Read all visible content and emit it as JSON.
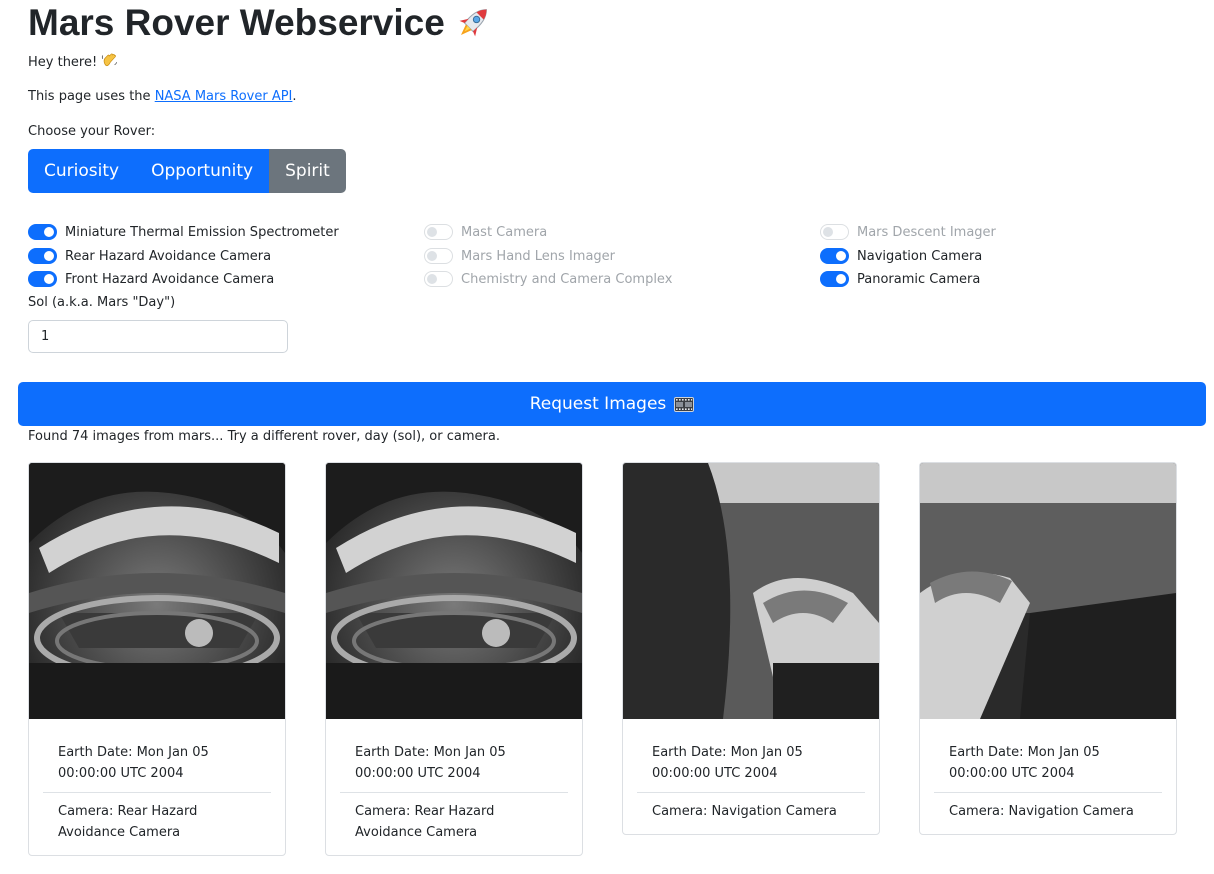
{
  "header": {
    "title": "Mars Rover Webservice"
  },
  "intro": {
    "greeting": "Hey there!",
    "api_prefix": "This page uses the ",
    "api_link": "NASA Mars Rover API",
    "api_suffix": ".",
    "rover_prompt": "Choose your Rover:"
  },
  "rovers": [
    {
      "label": "Curiosity",
      "selected": false
    },
    {
      "label": "Opportunity",
      "selected": false
    },
    {
      "label": "Spirit",
      "selected": true
    }
  ],
  "cameras": [
    {
      "label": "Miniature Thermal Emission Spectrometer",
      "on": true,
      "enabled": true
    },
    {
      "label": "Rear Hazard Avoidance Camera",
      "on": true,
      "enabled": true
    },
    {
      "label": "Front Hazard Avoidance Camera",
      "on": true,
      "enabled": true
    },
    {
      "label": "Mast Camera",
      "on": false,
      "enabled": false
    },
    {
      "label": "Mars Hand Lens Imager",
      "on": false,
      "enabled": false
    },
    {
      "label": "Chemistry and Camera Complex",
      "on": false,
      "enabled": false
    },
    {
      "label": "Mars Descent Imager",
      "on": false,
      "enabled": false
    },
    {
      "label": "Navigation Camera",
      "on": true,
      "enabled": true
    },
    {
      "label": "Panoramic Camera",
      "on": true,
      "enabled": true
    }
  ],
  "sol": {
    "label": "Sol (a.k.a. Mars \"Day\")",
    "value": "1"
  },
  "request": {
    "label": "Request Images"
  },
  "results": {
    "status": "Found 74 images from mars... Try a different rover, day (sol), or camera."
  },
  "photos": [
    {
      "earth_date": "Earth Date: Mon Jan 05 00:00:00 UTC 2004",
      "camera": "Camera: Rear Hazard Avoidance Camera"
    },
    {
      "earth_date": "Earth Date: Mon Jan 05 00:00:00 UTC 2004",
      "camera": "Camera: Rear Hazard Avoidance Camera"
    },
    {
      "earth_date": "Earth Date: Mon Jan 05 00:00:00 UTC 2004",
      "camera": "Camera: Navigation Camera"
    },
    {
      "earth_date": "Earth Date: Mon Jan 05 00:00:00 UTC 2004",
      "camera": "Camera: Navigation Camera"
    }
  ],
  "colors": {
    "primary": "#0d6efd",
    "secondary": "#6c757d",
    "text": "#212529",
    "border": "#dcdfe3"
  },
  "icons": {
    "title": "rocket-icon",
    "greeting": "waving-hand-icon",
    "request": "film-frames-icon"
  }
}
